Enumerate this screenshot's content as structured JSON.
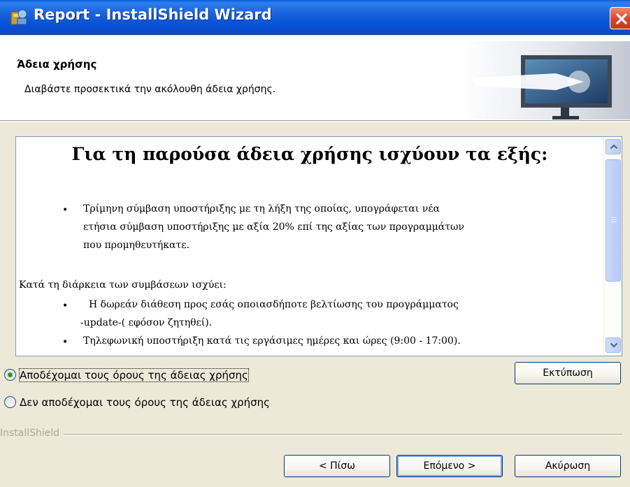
{
  "window": {
    "title": "Report - InstallShield Wizard"
  },
  "header": {
    "title": "Άδεια χρήσης",
    "subtitle": "Διαβάστε προσεκτικά την ακόλουθη άδεια χρήσης."
  },
  "license": {
    "heading": "Για τη παρούσα άδεια χρήσης ισχύουν τα εξής:",
    "bullet1_lines": [
      "Τρίμηνη σύμβαση υποστήριξης με τη λήξη της οποίας, υπογράφεται νέα",
      "ετήσια σύμβαση υποστήριξης με αξία 20% επί της αξίας των προγραμμάτων",
      "που προμηθευτήκατε."
    ],
    "intro": "Κατά τη διάρκεια των συμβάσεων ισχύει:",
    "bullet2_lines": [
      "Η δωρεάν διάθεση προς εσάς οποιασδήποτε βελτίωσης του προγράμματος",
      "-update-( εφόσον ζητηθεί)."
    ],
    "bullet3": "Τηλεφωνική υποστήριξη κατά τις εργάσιμες ημέρες και ώρες (9:00 - 17:00).",
    "bullet_char": "•"
  },
  "options": {
    "accept": "Αποδέχομαι τους όρους της άδειας χρήσης",
    "decline": "Δεν αποδέχομαι τους όρους της άδειας χρήσης",
    "selected": "accept"
  },
  "buttons": {
    "print": "Εκτύπωση",
    "back": "< Πίσω",
    "next": "Επόμενο >",
    "cancel": "Ακύρωση"
  },
  "brand": "InstallShield",
  "colors": {
    "titlebar": "#0a5cdb",
    "close": "#d9462a",
    "face": "#ece9d8",
    "radio_selected": "#21a121"
  }
}
